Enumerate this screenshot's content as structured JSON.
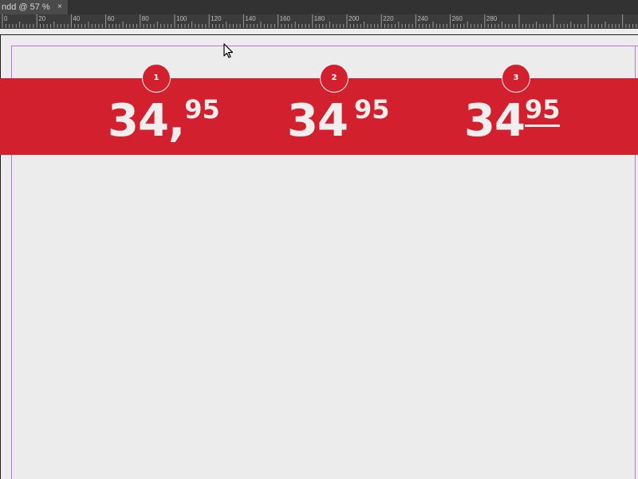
{
  "window": {
    "tab_title": "ndd @ 57 %",
    "close_glyph": "×"
  },
  "ruler": {
    "labels": [
      "0",
      "20",
      "40",
      "60",
      "80",
      "100",
      "120",
      "140",
      "160",
      "180",
      "200",
      "220",
      "240",
      "260",
      "280"
    ]
  },
  "colors": {
    "band": "#d2202e",
    "guide": "#b77bd6",
    "canvas": "#ececec"
  },
  "prices": [
    {
      "badge": "1",
      "main": "34,",
      "fraction": "95"
    },
    {
      "badge": "2",
      "main": "34",
      "fraction": "95"
    },
    {
      "badge": "3",
      "main": "34",
      "fraction": "95"
    }
  ],
  "icons": {
    "cursor": "arrow-cursor-icon",
    "close": "close-icon"
  }
}
